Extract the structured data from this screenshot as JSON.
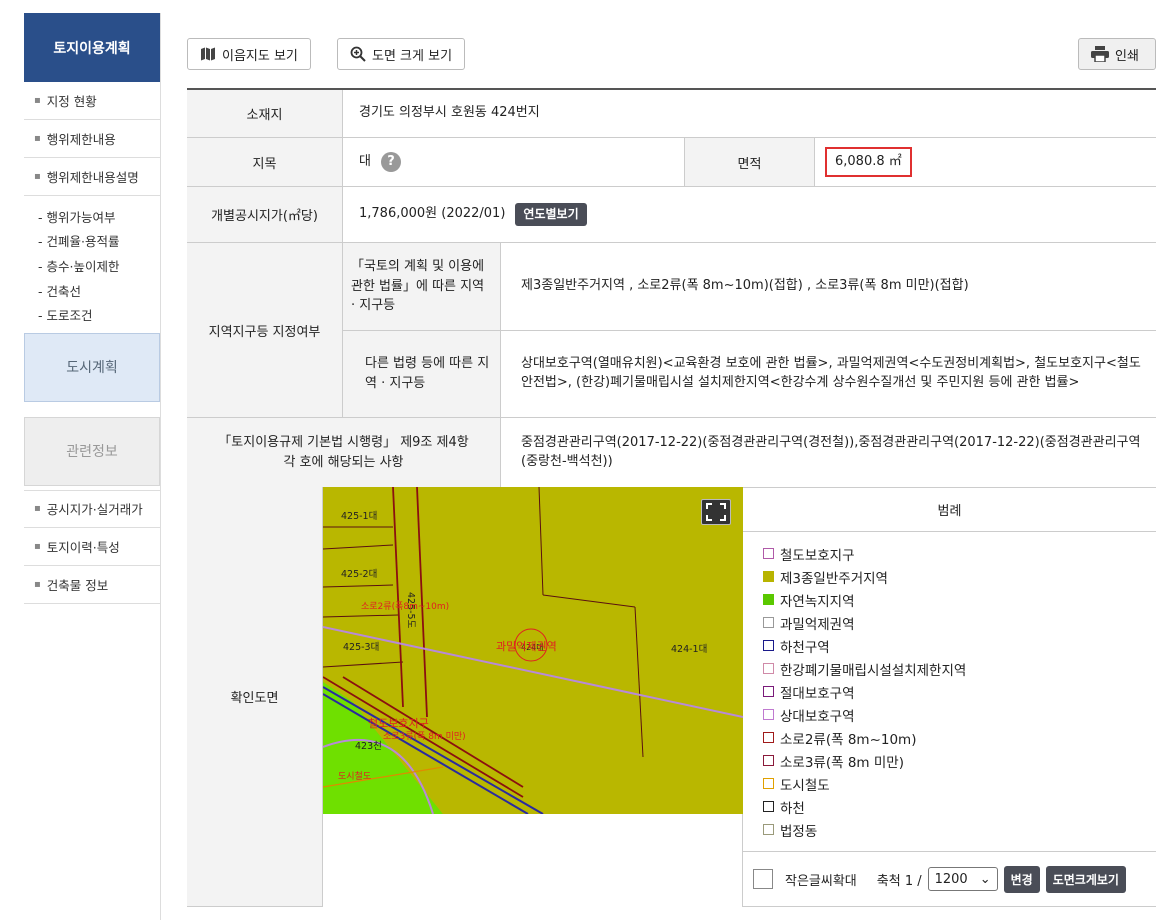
{
  "sidebar": {
    "title": "토지이용계획",
    "items_top": [
      "지정 현황",
      "행위제한내용",
      "행위제한내용설명"
    ],
    "sub_items": [
      "- 행위가능여부",
      "- 건폐율·용적률",
      "- 층수·높이제한",
      "- 건축선",
      "- 도로조건"
    ],
    "city_plan": "도시계획",
    "related": "관련정보",
    "items_bottom": [
      "공시지가·실거래가",
      "토지이력·특성",
      "건축물 정보"
    ]
  },
  "toolbar": {
    "map_label": "이음지도 보기",
    "zoom_label": "도면 크게 보기",
    "print_label": "인쇄"
  },
  "info": {
    "location_label": "소재지",
    "location_value": "경기도 의정부시 호원동 424번지",
    "jimok_label": "지목",
    "jimok_value": "대",
    "help": "?",
    "area_label": "면적",
    "area_value": "6,080.8 ㎡",
    "price_label": "개별공시지가(㎡당)",
    "price_value": "1,786,000원 (2022/01)",
    "price_button": "연도별보기",
    "zone_label": "지역지구등 지정여부",
    "law1_label": "「국토의 계획 및 이용에 관한 법률」에 따른 지역 · 지구등",
    "law1_value": "제3종일반주거지역 , 소로2류(폭 8m~10m)(접합) , 소로3류(폭 8m 미만)(접합)",
    "law2_label": "다른 법령 등에 따른 지역 · 지구등",
    "law2_value": "상대보호구역(열매유치원)<교육환경 보호에 관한 법률>, 과밀억제권역<수도권정비계획법>, 철도보호지구<철도안전법>, (한강)폐기물매립시설 설치제한지역<한강수계 상수원수질개선 및 주민지원 등에 관한 법률>",
    "reg_label": "「토지이용규제 기본법 시행령」 제9조 제4항 각 호에 해당되는 사항",
    "reg_value": "중점경관관리구역(2017-12-22)(중점경관관리구역(경전철)),중점경관관리구역(2017-12-22)(중점경관관리구역(중랑천-백석천))"
  },
  "map": {
    "label": "확인도면",
    "parcels": [
      "425-1대",
      "425-2대",
      "425-3대",
      "424-1대",
      "425-5도",
      "424대",
      "423천"
    ],
    "annotations": [
      "소로2류(폭8m~10m)",
      "과밀억제권역",
      "철도보호지구",
      "소로3류(폭 8m 미만)",
      "도시철도"
    ]
  },
  "legend": {
    "title": "범례",
    "items": [
      {
        "label": "철도보호지구",
        "color": "#b05aa8"
      },
      {
        "label": "제3종일반주거지역",
        "color": "#b8b400"
      },
      {
        "label": "자연녹지지역",
        "color": "#5ac800"
      },
      {
        "label": "과밀억제권역",
        "color": "#999999"
      },
      {
        "label": "하천구역",
        "color": "#1a1a8a"
      },
      {
        "label": "한강폐기물매립시설설치제한지역",
        "color": "#d08aa8"
      },
      {
        "label": "절대보호구역",
        "color": "#7a1a7a"
      },
      {
        "label": "상대보호구역",
        "color": "#c07ad0"
      },
      {
        "label": "소로2류(폭 8m~10m)",
        "color": "#a01a1a"
      },
      {
        "label": "소로3류(폭 8m 미만)",
        "color": "#8a1a3a"
      },
      {
        "label": "도시철도",
        "color": "#e0a000"
      },
      {
        "label": "하천",
        "color": "#222222"
      },
      {
        "label": "법정동",
        "color": "#9a9a7a"
      }
    ],
    "small_text": "작은글씨확대",
    "scale_label": "축척 1 /",
    "scale_value": "1200",
    "change_button": "변경",
    "enlarge_button": "도면크게보기"
  }
}
